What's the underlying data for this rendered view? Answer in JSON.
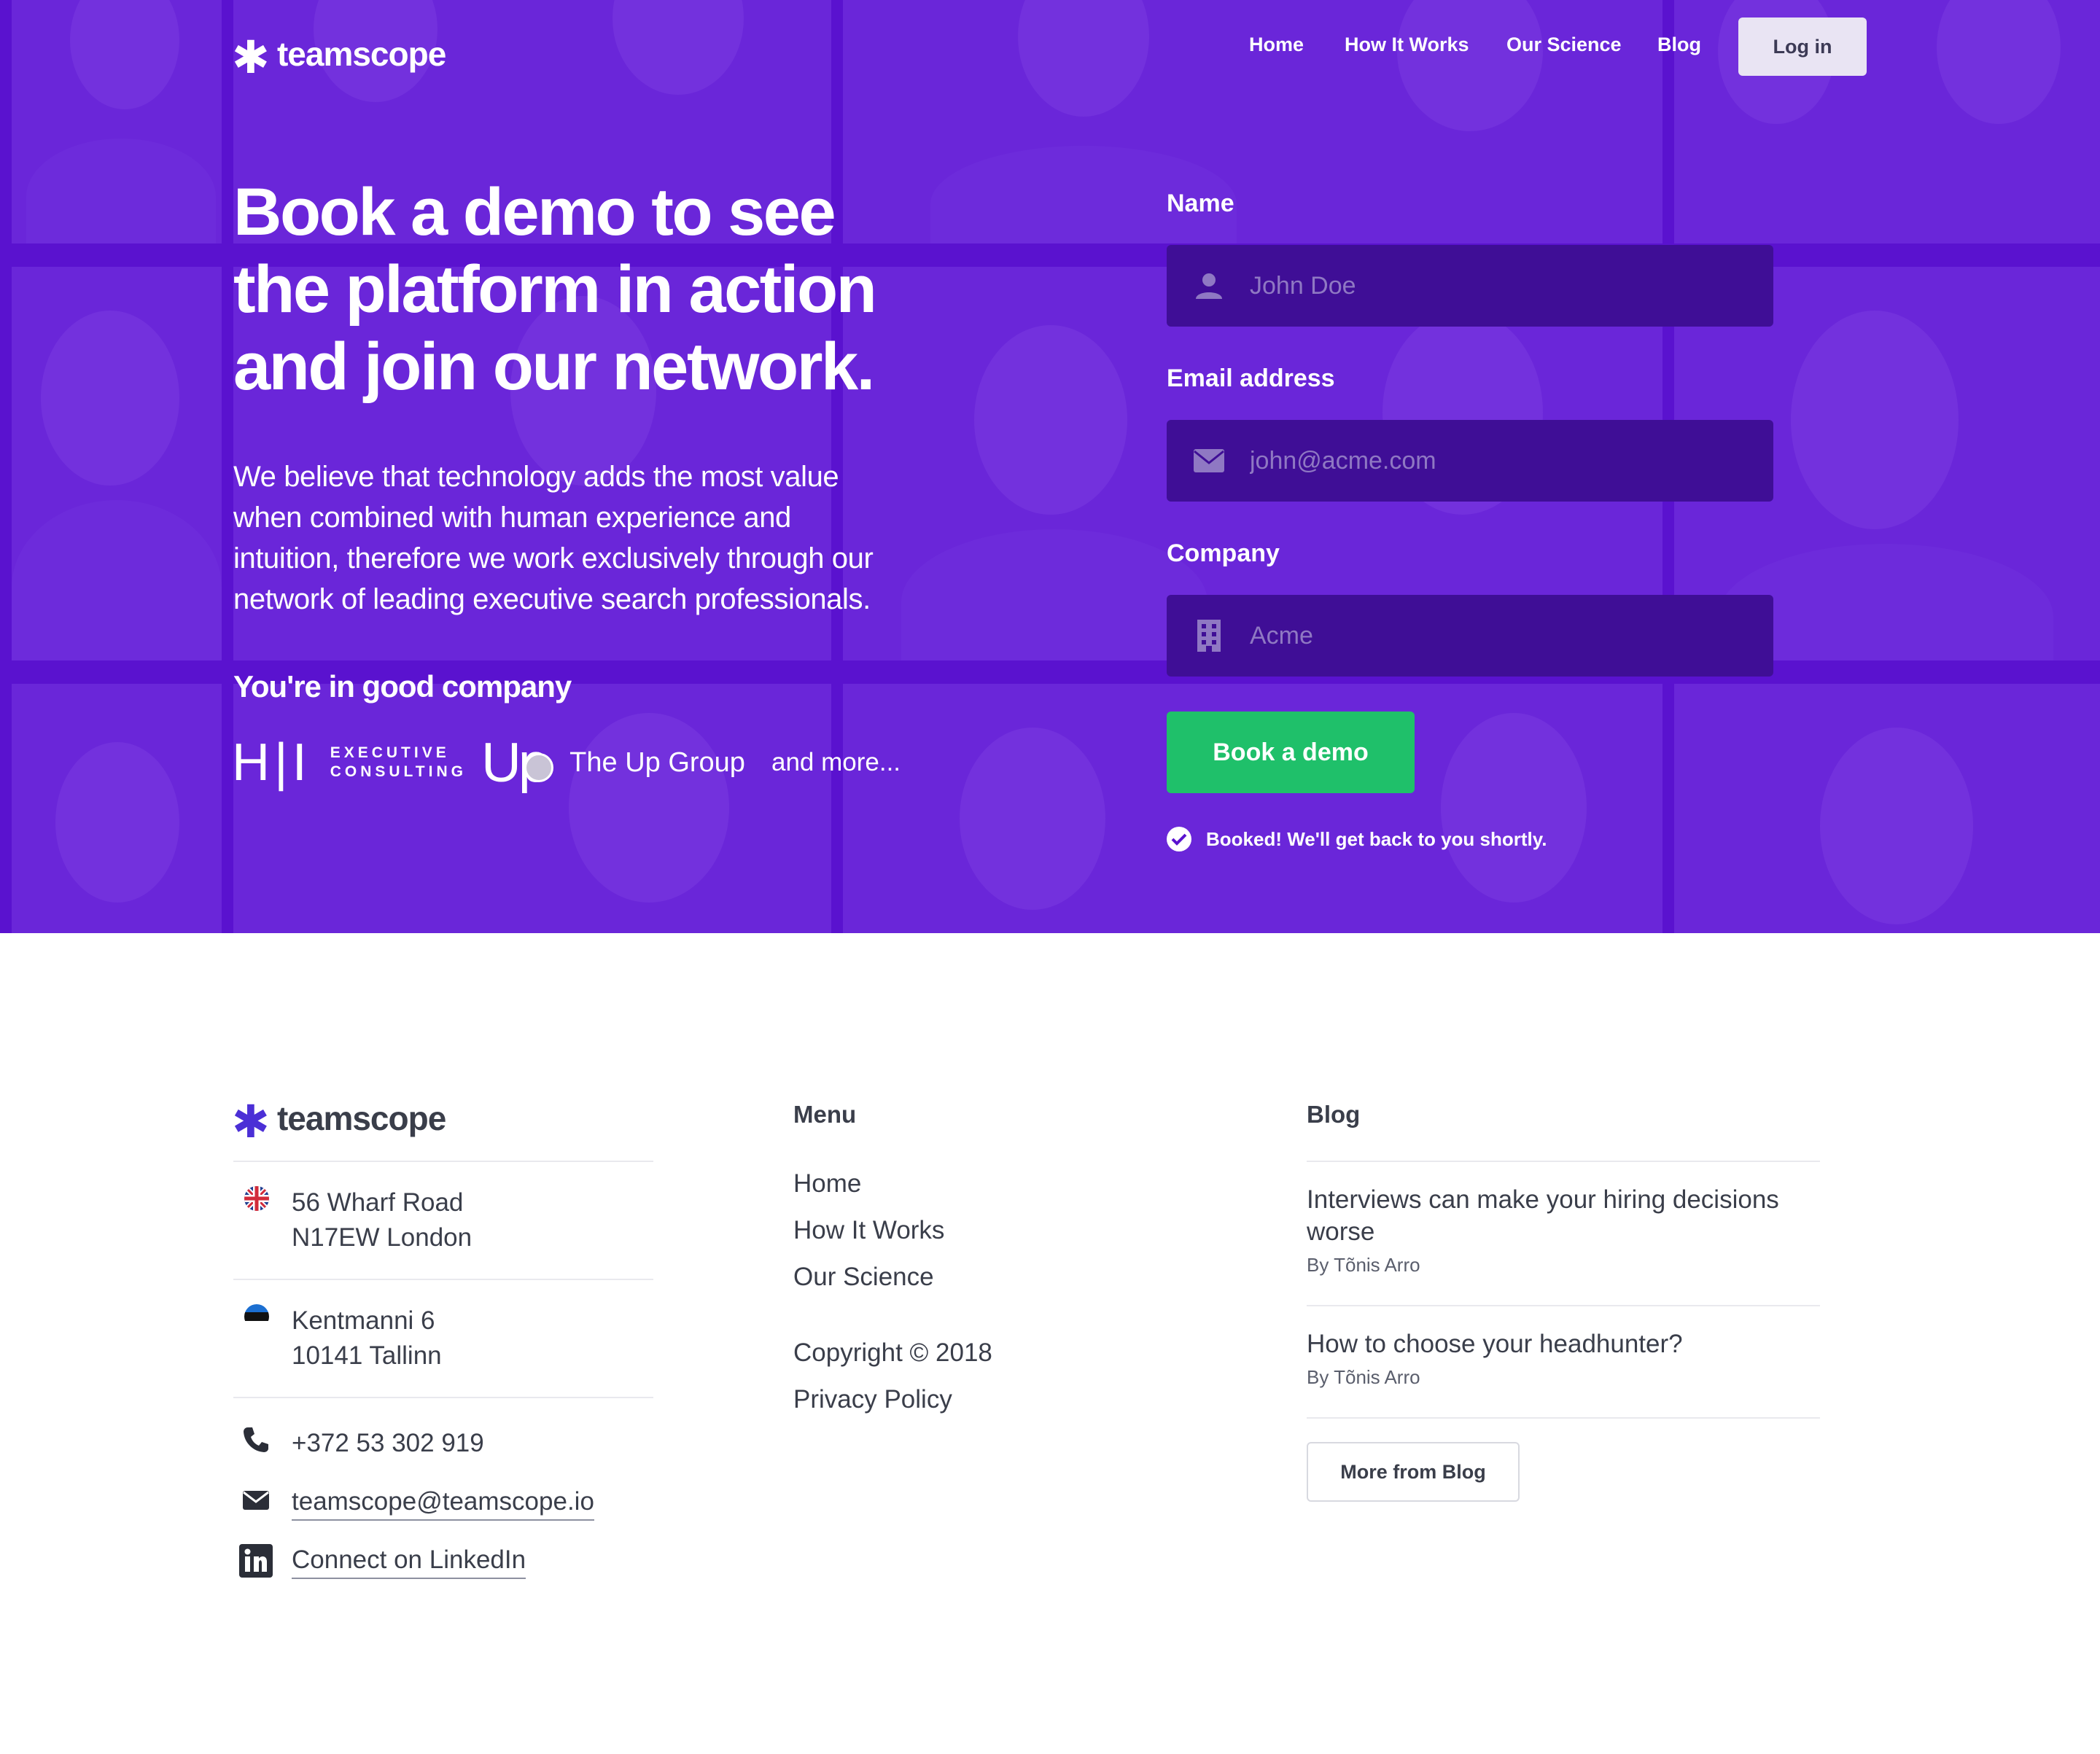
{
  "brand": {
    "name": "teamscope"
  },
  "nav": {
    "items": [
      "Home",
      "How It Works",
      "Our Science",
      "Blog"
    ],
    "login_label": "Log in"
  },
  "hero": {
    "headline_lines": [
      "Book a demo to see",
      "the platform in action",
      "and join our network."
    ],
    "intro_lines": [
      "We believe that technology adds the most value",
      "when combined with human experience and",
      "intuition, therefore we work exclusively through our",
      "network of leading executive search professionals."
    ],
    "company_heading": "You're in good company",
    "partners": {
      "hi_mark": "H|I",
      "hi_line1": "EXECUTIVE",
      "hi_line2": "CONSULTING",
      "up_mark": "Up",
      "up_name": "The Up Group",
      "more": "and more..."
    }
  },
  "form": {
    "name_label": "Name",
    "name_placeholder": "John Doe",
    "email_label": "Email address",
    "email_placeholder": "john@acme.com",
    "company_label": "Company",
    "company_placeholder": "Acme",
    "submit_label": "Book a demo",
    "confirmation": "Booked! We'll get back to you shortly."
  },
  "footer": {
    "address_uk": [
      "56 Wharf Road",
      "N17EW London"
    ],
    "address_ee": [
      "Kentmanni 6",
      "10141 Tallinn"
    ],
    "phone": "+372 53 302 919",
    "email": "teamscope@teamscope.io",
    "linkedin": "Connect on LinkedIn",
    "menu_heading": "Menu",
    "menu_items": [
      "Home",
      "How It Works",
      "Our Science"
    ],
    "copyright": "Copyright © 2018",
    "privacy": "Privacy Policy",
    "blog_heading": "Blog",
    "posts": [
      {
        "title_lines": [
          "Interviews can make your hiring decisions",
          "worse"
        ],
        "author": "By Tõnis Arro"
      },
      {
        "title_lines": [
          "How to choose your headhunter?"
        ],
        "author": "By Tõnis Arro"
      }
    ],
    "more_blog_label": "More from Blog"
  },
  "colors": {
    "hero_bg": "#5a12cf",
    "input_bg": "#3f0e96",
    "cta_green": "#1fc06a",
    "brand_star_footer": "#4b2fd6",
    "text_dark": "#3a3e4a"
  },
  "icons": [
    "asterisk-logo-icon",
    "user-icon",
    "envelope-icon",
    "building-icon",
    "check-circle-icon",
    "uk-flag-icon",
    "estonia-flag-icon",
    "phone-icon",
    "linkedin-icon"
  ]
}
